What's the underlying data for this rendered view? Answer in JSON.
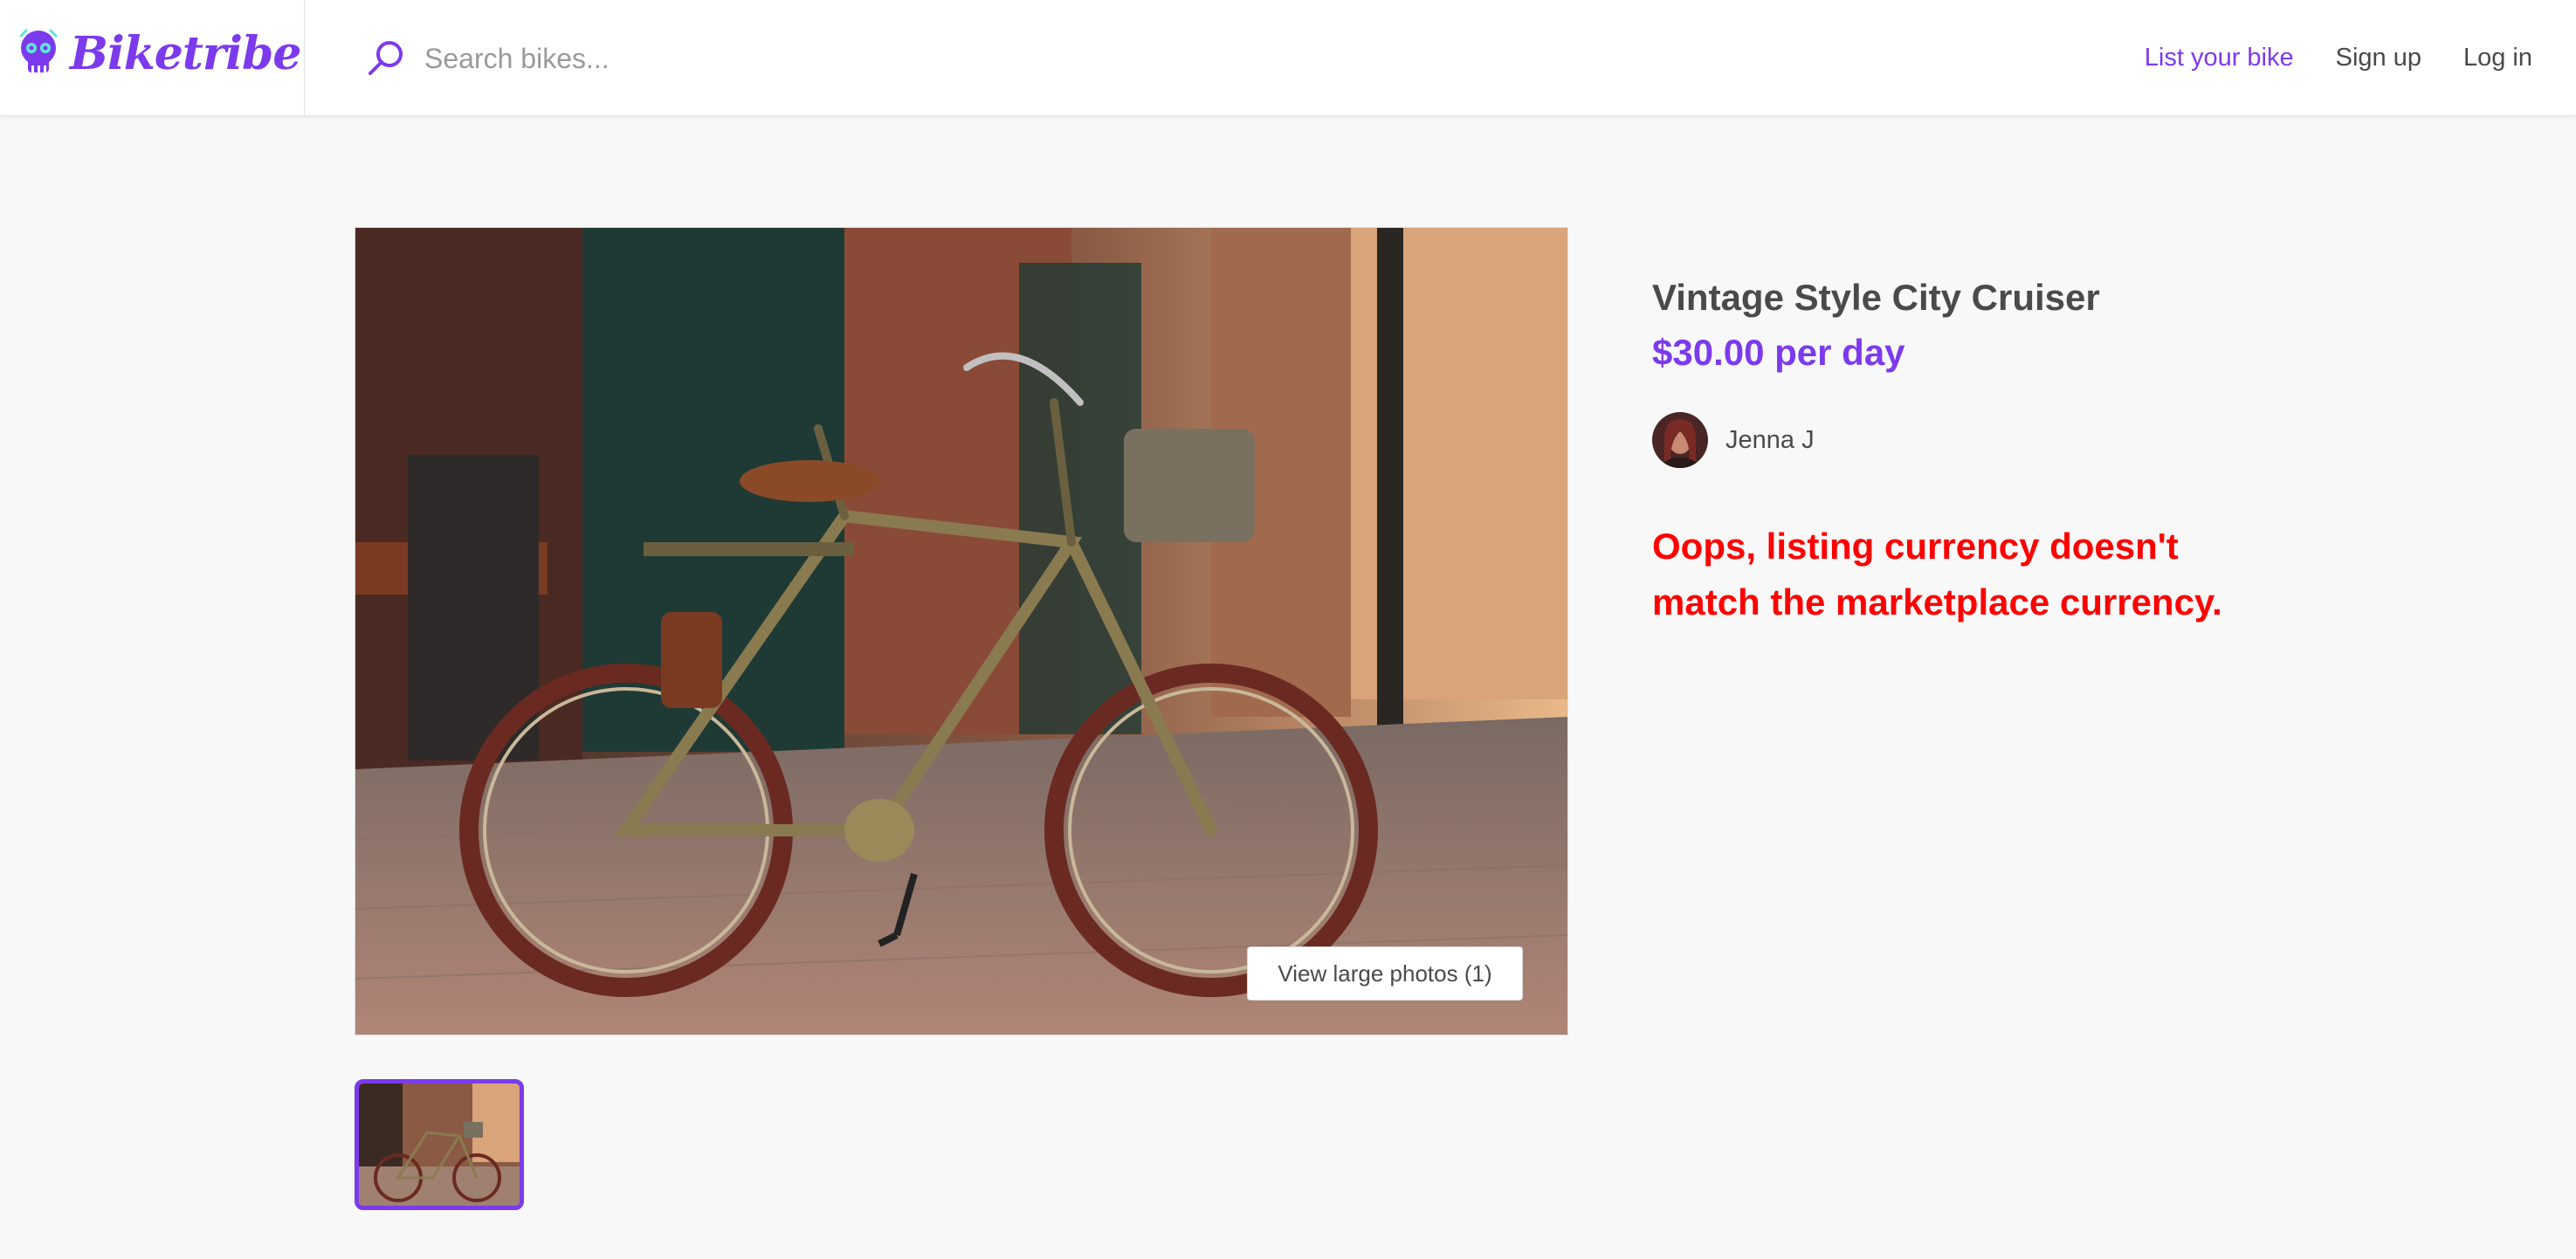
{
  "topbar": {
    "logo_text": "Biketribe",
    "search_placeholder": "Search bikes...",
    "nav": {
      "list_your_bike": "List your bike",
      "sign_up": "Sign up",
      "log_in": "Log in"
    }
  },
  "listing": {
    "title": "Vintage Style City Cruiser",
    "price": "$30.00 per day",
    "author_name": "Jenna J",
    "error_message": "Oops, listing currency doesn't match the marketplace currency.",
    "view_photos_label": "View large photos (1)",
    "main_image_desc": "vintage-city-cruiser-bicycle-photo"
  },
  "colors": {
    "accent": "#7c3aed",
    "error": "#ff0000",
    "text": "#4a4a4a",
    "background": "#f8f8f8"
  }
}
